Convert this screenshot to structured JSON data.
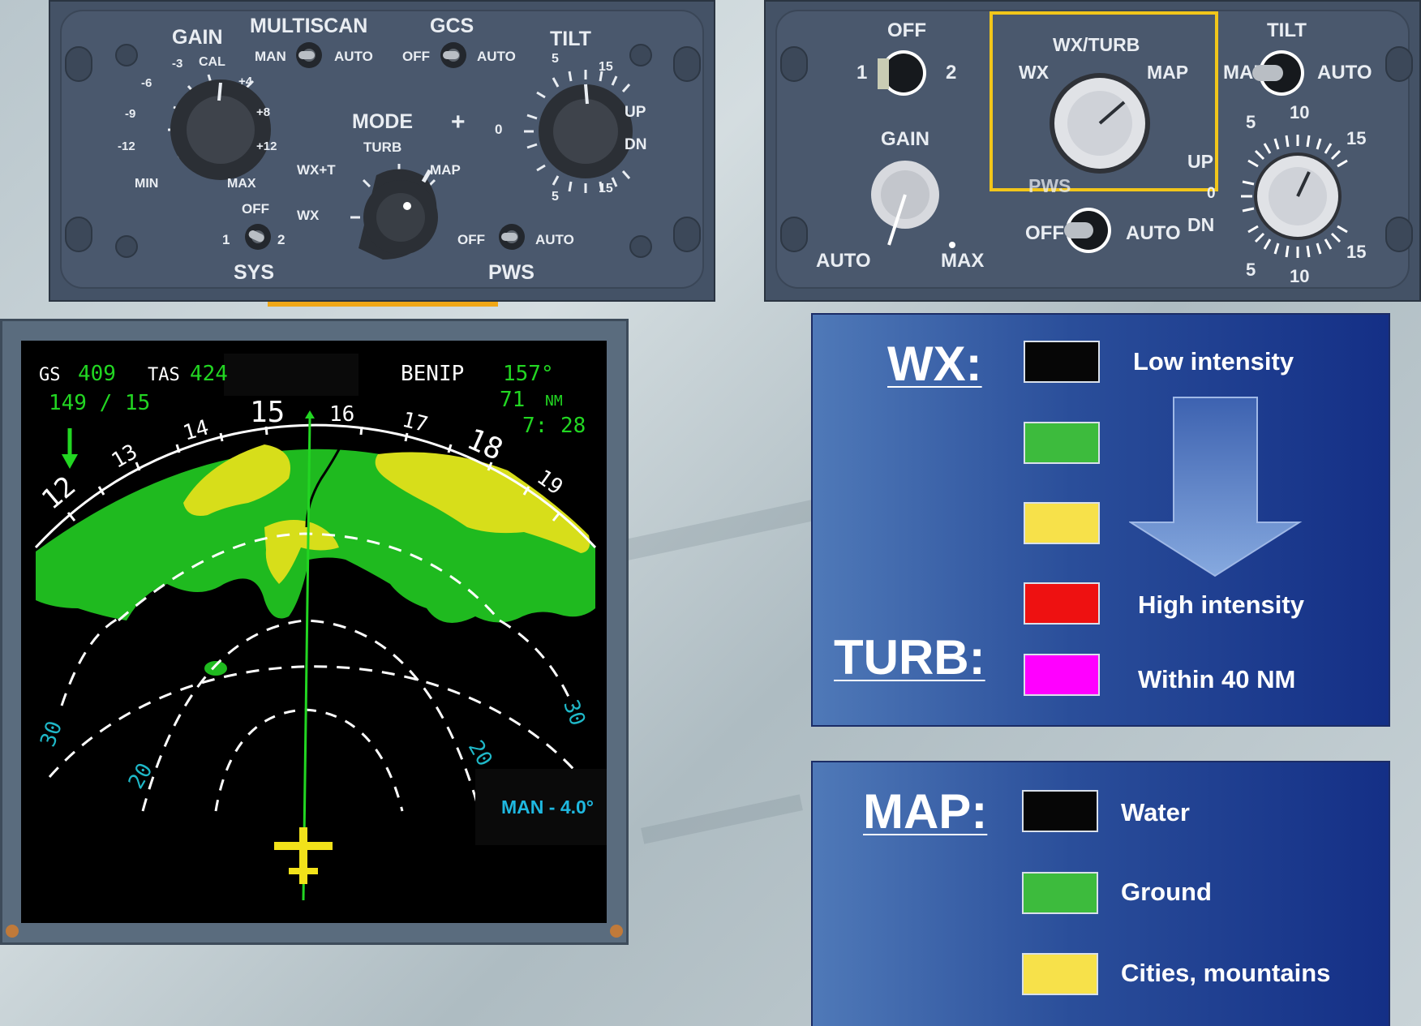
{
  "left_panel": {
    "gain": {
      "title": "GAIN",
      "cal": "CAL",
      "ticks": [
        "-3",
        "-6",
        "-9",
        "-12",
        "MIN",
        "MAX",
        "+12",
        "+8",
        "+4"
      ]
    },
    "multiscan": {
      "title": "MULTISCAN",
      "man": "MAN",
      "auto": "AUTO"
    },
    "gcs": {
      "title": "GCS",
      "off": "OFF",
      "auto": "AUTO"
    },
    "tilt": {
      "title": "TILT",
      "zero": "0",
      "up": "UP",
      "dn": "DN",
      "ticks_top": [
        "5",
        "15"
      ],
      "ticks_bottom": [
        "5",
        "15"
      ]
    },
    "plus": "+",
    "mode": {
      "title": "MODE",
      "turb": "TURB",
      "wxt": "WX+T",
      "map": "MAP",
      "wx": "WX"
    },
    "sys": {
      "title": "SYS",
      "off": "OFF",
      "one": "1",
      "two": "2"
    },
    "pws": {
      "title": "PWS",
      "off": "OFF",
      "auto": "AUTO"
    }
  },
  "right_panel": {
    "sys": {
      "off": "OFF",
      "one": "1",
      "two": "2"
    },
    "gain": {
      "title": "GAIN",
      "auto": "AUTO",
      "max": "MAX"
    },
    "wxturb": {
      "title": "WX/TURB",
      "wx": "WX",
      "map": "MAP"
    },
    "pws": {
      "title": "PWS",
      "off": "OFF",
      "auto": "AUTO"
    },
    "tilt": {
      "title": "TILT",
      "man": "MAN",
      "auto": "AUTO",
      "up": "UP",
      "dn": "DN",
      "zero": "0",
      "t10": "10",
      "t5": "5",
      "t15": "15",
      "b15": "15",
      "b5": "5",
      "b10": "10"
    }
  },
  "radar": {
    "gs_label": "GS",
    "gs_value": "409",
    "tas_label": "TAS",
    "tas_value": "424",
    "wind": "149 / 15",
    "waypoint": "BENIP",
    "waypoint_brg": "157°",
    "waypoint_dist": "71",
    "waypoint_unit": "NM",
    "eta": "7: 28",
    "headings": [
      "12",
      "13",
      "14",
      "15",
      "16",
      "17",
      "18",
      "19"
    ],
    "range_labels": [
      "30",
      "20",
      "20",
      "30"
    ],
    "tilt_readout": "MAN - 4.0°"
  },
  "legend_wx": {
    "wx_heading": "WX:",
    "turb_heading": "TURB:",
    "low": "Low intensity",
    "high": "High intensity",
    "within": "Within 40 NM",
    "colors": [
      "#060606",
      "#3dbb3d",
      "#f7e14a",
      "#ee1111",
      "#ff00ff"
    ]
  },
  "legend_map": {
    "map_heading": "MAP:",
    "water": "Water",
    "ground": "Ground",
    "cities": "Cities, mountains",
    "colors": [
      "#060606",
      "#3dbb3d",
      "#f7e14a"
    ]
  }
}
